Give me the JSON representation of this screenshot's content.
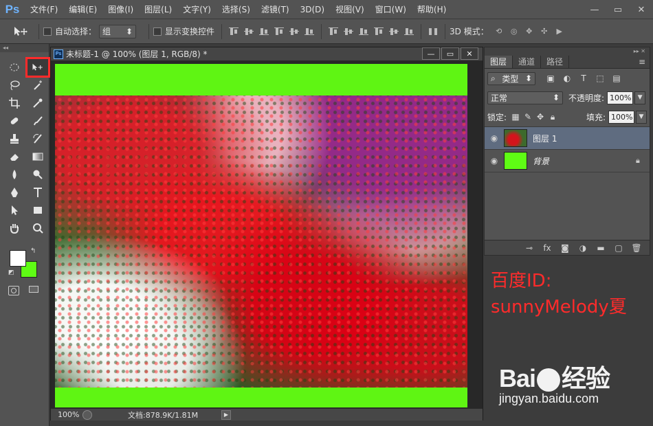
{
  "app": {
    "logo": "Ps"
  },
  "menu": [
    "文件(F)",
    "编辑(E)",
    "图像(I)",
    "图层(L)",
    "文字(Y)",
    "选择(S)",
    "滤镜(T)",
    "3D(D)",
    "视图(V)",
    "窗口(W)",
    "帮助(H)"
  ],
  "window_controls": {
    "minimize": "—",
    "restore": "▭",
    "close": "✕"
  },
  "options_bar": {
    "auto_select_label": "自动选择：",
    "auto_select_value": "组",
    "show_transform_label": "显示变换控件",
    "mode_3d_label": "3D 模式："
  },
  "document": {
    "title": "未标题-1 @ 100% (图层 1, RGB/8) *",
    "zoom": "100%",
    "doc_info": "文档:878.9K/1.81M"
  },
  "colors": {
    "foreground": "#ffffff",
    "background": "#5ffc14",
    "highlight": "#ff2b2b"
  },
  "layers_panel": {
    "tabs": [
      "图层",
      "通道",
      "路径"
    ],
    "filter_type": "类型",
    "blend_mode": "正常",
    "opacity_label": "不透明度:",
    "opacity_value": "100%",
    "lock_label": "锁定:",
    "fill_label": "填充:",
    "fill_value": "100%",
    "layers": [
      {
        "name": "图层 1",
        "visible": true,
        "selected": true
      },
      {
        "name": "背景",
        "visible": true,
        "locked": true
      }
    ]
  },
  "watermark": {
    "line1": "百度ID:",
    "line2": "sunnyMelody夏",
    "logo_left": "Bai",
    "logo_right": "经验",
    "url": "jingyan.baidu.com"
  }
}
